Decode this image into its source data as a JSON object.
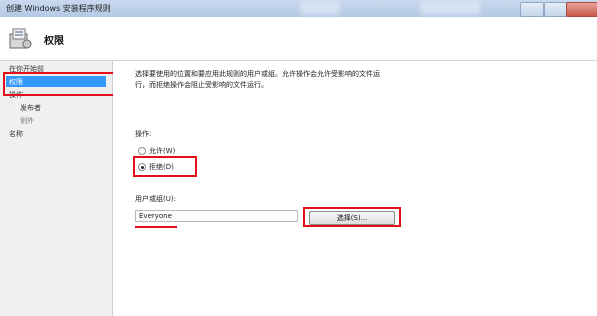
{
  "window": {
    "title": "创建 Windows 安装程序规则"
  },
  "header": {
    "title": "权限"
  },
  "sidebar": {
    "items": [
      {
        "label": "在你开始前"
      },
      {
        "label": "权限"
      },
      {
        "label": "操作"
      },
      {
        "label": "发布者"
      },
      {
        "label": "例外"
      },
      {
        "label": "名称"
      }
    ]
  },
  "main": {
    "description_line1": "选择要使用的位置和要应用此规则的用户或组。允许操作会允许受影响的文件运",
    "description_line2": "行，而拒绝操作会阻止受影响的文件运行。",
    "action_label": "操作:",
    "allow_label": "允许(W)",
    "deny_label": "拒绝(D)",
    "selected_action": "拒绝(D)",
    "user_group_label": "用户或组(U):",
    "user_group_value": "Everyone",
    "select_button": "选择(S)..."
  },
  "colors": {
    "highlight": "#e1101a",
    "selection": "#3399ff"
  }
}
